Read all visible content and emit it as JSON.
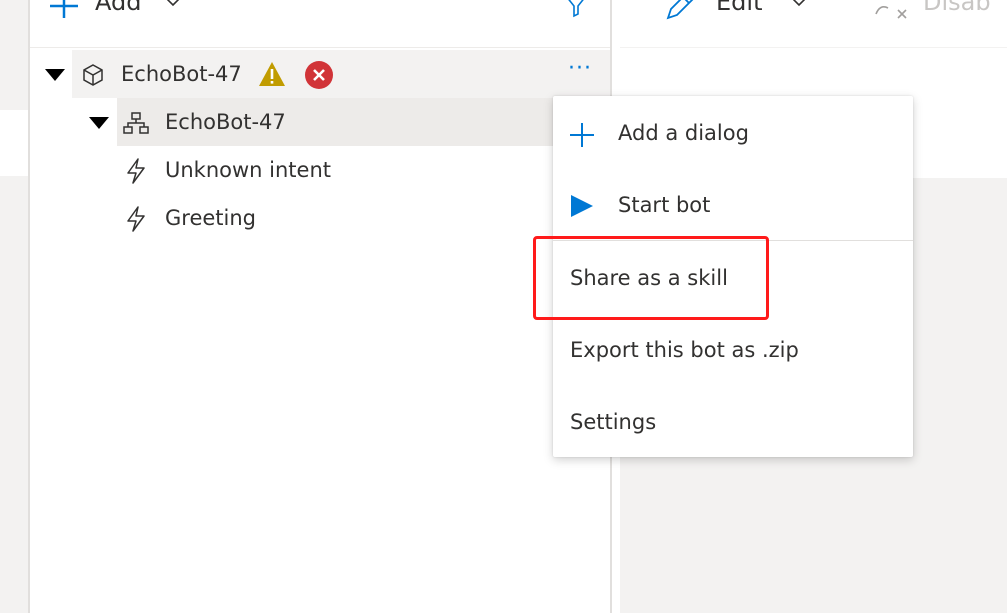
{
  "toolbar": {
    "add_label": "Add",
    "edit_label": "Edit",
    "disable_label": "Disab"
  },
  "tree": {
    "root": {
      "label": "EchoBot-47",
      "has_warning": true,
      "has_error": true
    },
    "dialog": {
      "label": "EchoBot-47"
    },
    "triggers": [
      {
        "label": "Unknown intent"
      },
      {
        "label": "Greeting"
      }
    ]
  },
  "context_menu": {
    "items": [
      {
        "label": "Add a dialog",
        "icon": "plus-icon"
      },
      {
        "label": "Start bot",
        "icon": "play-icon"
      },
      {
        "label": "Share as a skill"
      },
      {
        "label": "Export this bot as .zip"
      },
      {
        "label": "Settings"
      }
    ],
    "highlighted": "Share as a skill"
  },
  "colors": {
    "accent": "#0078d4",
    "warning": "#c19c00",
    "error": "#d13438",
    "highlight": "#ff1a1a"
  }
}
